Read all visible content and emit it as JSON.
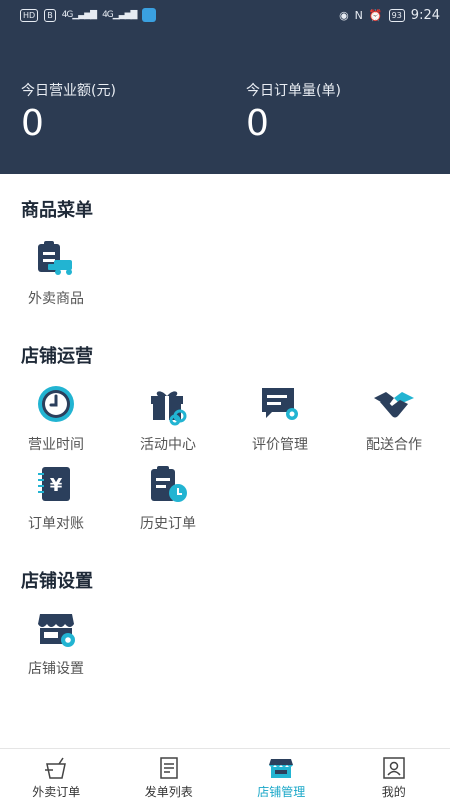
{
  "status_bar": {
    "left_badge": "HD",
    "left_badge2": "B",
    "network1": "4G",
    "network2": "4G",
    "battery": "93",
    "time": "9:24"
  },
  "stats": {
    "revenue_label": "今日营业额(元)",
    "revenue_value": "0",
    "orders_label": "今日订单量(单)",
    "orders_value": "0"
  },
  "sections": {
    "goods": {
      "title": "商品菜单",
      "items": [
        {
          "label": "外卖商品",
          "icon": "takeout-goods-icon"
        }
      ]
    },
    "operation": {
      "title": "店铺运营",
      "items": [
        {
          "label": "营业时间",
          "icon": "clock-icon"
        },
        {
          "label": "活动中心",
          "icon": "gift-icon"
        },
        {
          "label": "评价管理",
          "icon": "review-icon"
        },
        {
          "label": "配送合作",
          "icon": "handshake-icon"
        },
        {
          "label": "订单对账",
          "icon": "reconcile-icon"
        },
        {
          "label": "历史订单",
          "icon": "history-icon"
        }
      ]
    },
    "settings": {
      "title": "店铺设置",
      "items": [
        {
          "label": "店铺设置",
          "icon": "store-settings-icon"
        }
      ]
    }
  },
  "tabbar": {
    "tabs": [
      {
        "label": "外卖订单",
        "icon": "drink-icon"
      },
      {
        "label": "发单列表",
        "icon": "list-icon"
      },
      {
        "label": "店铺管理",
        "icon": "store-icon",
        "active": true
      },
      {
        "label": "我的",
        "icon": "profile-icon"
      }
    ]
  },
  "colors": {
    "header_bg": "#2c3b52",
    "icon_dark": "#2b3f5c",
    "accent": "#22b4d2"
  }
}
